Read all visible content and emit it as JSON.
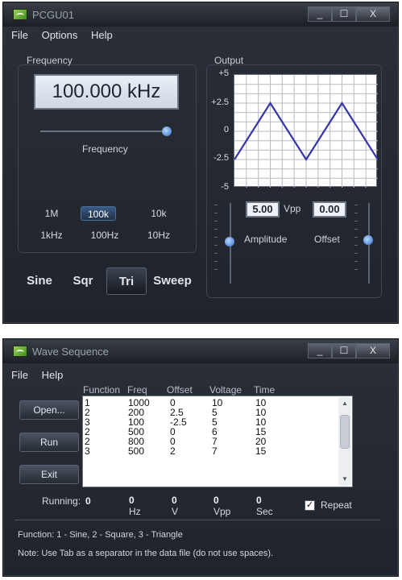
{
  "pcgu": {
    "title": "PCGU01",
    "menu": [
      "File",
      "Options",
      "Help"
    ],
    "window_buttons": [
      "_",
      "☐",
      "X"
    ],
    "frequency": {
      "group_label": "Frequency",
      "display": "100.000 kHz",
      "slider_label": "Frequency",
      "ranges_row1": [
        "1M",
        "100k",
        "10k"
      ],
      "ranges_row2": [
        "1kHz",
        "100Hz",
        "10Hz"
      ],
      "active_range": "100k"
    },
    "waveforms": [
      "Sine",
      "Sqr",
      "Tri",
      "Sweep"
    ],
    "active_waveform": "Tri",
    "output": {
      "group_label": "Output",
      "y_ticks": [
        "+5",
        "+2.5",
        "0",
        "-2.5",
        "-5"
      ],
      "amplitude_value": "5.00",
      "amplitude_unit": "Vpp",
      "offset_value": "0.00",
      "amplitude_label": "Amplitude",
      "offset_label": "Offset"
    }
  },
  "wave_sequence": {
    "title": "Wave Sequence",
    "window_buttons": [
      "_",
      "☐",
      "X"
    ],
    "menu": [
      "File",
      "Help"
    ],
    "buttons": [
      "Open...",
      "Run",
      "Exit"
    ],
    "columns": [
      "Function",
      "Freq",
      "Offset",
      "Voltage",
      "Time"
    ],
    "rows": [
      [
        "1",
        "1000",
        "0",
        "10",
        "10"
      ],
      [
        "2",
        "200",
        "2.5",
        "5",
        "10"
      ],
      [
        "3",
        "100",
        "-2.5",
        "5",
        "10"
      ],
      [
        "2",
        "500",
        "0",
        "6",
        "15"
      ],
      [
        "2",
        "800",
        "0",
        "7",
        "20"
      ],
      [
        "3",
        "500",
        "2",
        "7",
        "15"
      ]
    ],
    "running": {
      "label": "Running:",
      "value": "0",
      "stats": [
        {
          "value": "0",
          "unit": "Hz"
        },
        {
          "value": "0",
          "unit": "V"
        },
        {
          "value": "0",
          "unit": "Vpp"
        },
        {
          "value": "0",
          "unit": "Sec"
        }
      ],
      "repeat_label": "Repeat",
      "repeat_checked": "✓"
    },
    "notes": [
      "Function: 1 - Sine, 2 - Square, 3 - Triangle",
      "Note: Use Tab as a separator in the data file (do not use spaces)."
    ]
  }
}
